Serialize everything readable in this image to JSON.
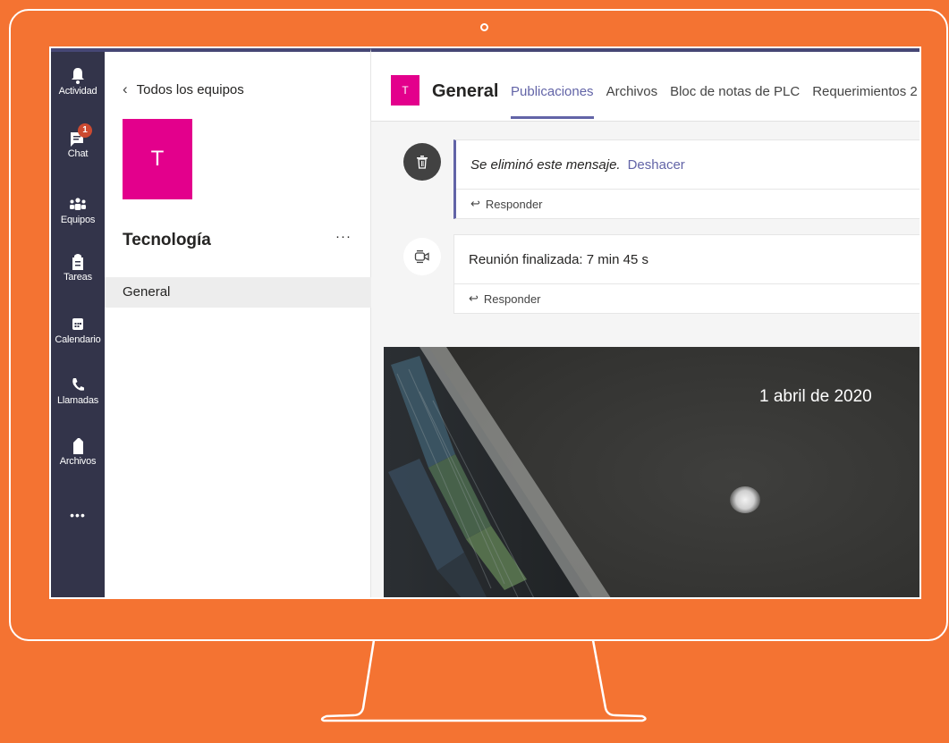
{
  "rail": {
    "items": [
      {
        "label": "Actividad",
        "icon": "bell-icon"
      },
      {
        "label": "Chat",
        "icon": "chat-icon",
        "badge": "1"
      },
      {
        "label": "Equipos",
        "icon": "teams-icon"
      },
      {
        "label": "Tareas",
        "icon": "assignments-icon"
      },
      {
        "label": "Calendario",
        "icon": "calendar-icon"
      },
      {
        "label": "Llamadas",
        "icon": "phone-icon"
      },
      {
        "label": "Archivos",
        "icon": "file-icon"
      }
    ],
    "more": "•••"
  },
  "team_panel": {
    "back_label": "Todos los equipos",
    "avatar_letter": "T",
    "team_name": "Tecnología",
    "more": "···",
    "channels": [
      {
        "label": "General"
      }
    ]
  },
  "channel": {
    "avatar_letter": "T",
    "title": "General",
    "tabs": [
      {
        "label": "Publicaciones",
        "active": true
      },
      {
        "label": "Archivos"
      },
      {
        "label": "Bloc de notas de PLC"
      },
      {
        "label": "Requerimientos 2"
      }
    ]
  },
  "posts": [
    {
      "text": "Se eliminó este mensaje.",
      "action": "Deshacer",
      "reply": "Responder",
      "icon": "trash-icon"
    },
    {
      "text": "Reunión finalizada: 7 min 45 s",
      "reply": "Responder",
      "icon": "meeting-icon"
    }
  ],
  "photo": {
    "date": "1 abril de 2020"
  },
  "colors": {
    "background": "#f47332",
    "rail": "#33344a",
    "accent": "#6264a7",
    "team_avatar": "#e3008c",
    "badge": "#cc4a31"
  }
}
